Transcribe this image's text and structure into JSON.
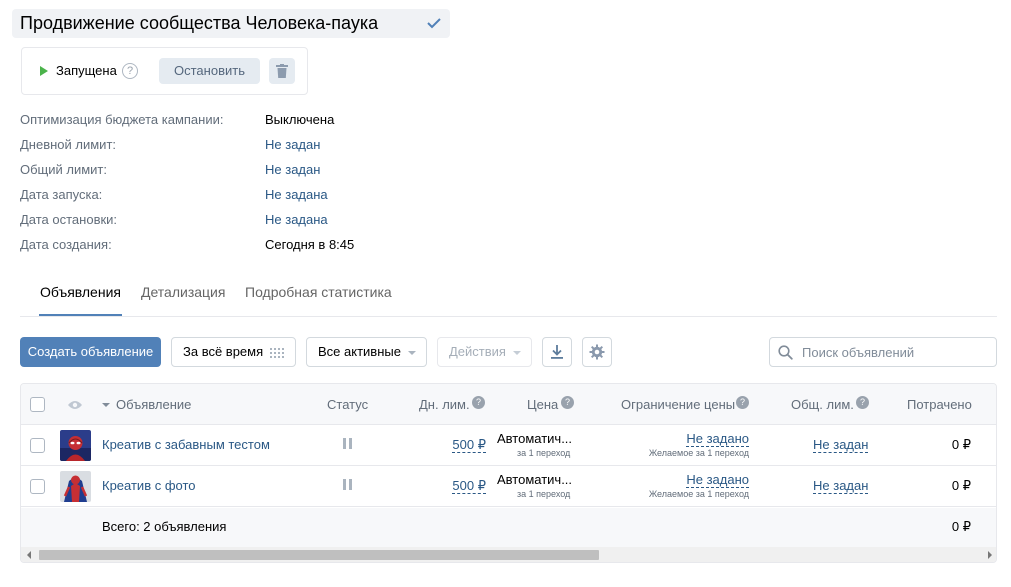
{
  "campaign": {
    "title": "Продвижение сообщества Человека-паука",
    "status_label": "Запущена",
    "help_glyph": "?",
    "stop_label": "Остановить"
  },
  "info": [
    {
      "label": "Оптимизация бюджета кампании:",
      "value": "Выключена",
      "link": false
    },
    {
      "label": "Дневной лимит:",
      "value": "Не задан",
      "link": true
    },
    {
      "label": "Общий лимит:",
      "value": "Не задан",
      "link": true
    },
    {
      "label": "Дата запуска:",
      "value": "Не задана",
      "link": true
    },
    {
      "label": "Дата остановки:",
      "value": "Не задана",
      "link": true
    },
    {
      "label": "Дата создания:",
      "value": "Сегодня в 8:45",
      "link": false
    }
  ],
  "tabs": [
    {
      "label": "Объявления",
      "active": true
    },
    {
      "label": "Детализация",
      "active": false
    },
    {
      "label": "Подробная статистика",
      "active": false
    }
  ],
  "toolbar": {
    "create_label": "Создать объявление",
    "period_label": "За всё время",
    "filter_label": "Все активные",
    "actions_label": "Действия",
    "search_placeholder": "Поиск объявлений"
  },
  "table": {
    "headers": {
      "ad": "Объявление",
      "status": "Статус",
      "daily_limit": "Дн. лим.",
      "price": "Цена",
      "price_limit": "Ограничение цены",
      "total_limit": "Общ. лим.",
      "spent": "Потрачено"
    },
    "rows": [
      {
        "name": "Креатив с забавным тестом",
        "daily_limit": "500 ₽",
        "price": "Автоматич...",
        "price_sub": "за 1 переход",
        "price_limit": "Не задано",
        "price_limit_sub": "Желаемое за 1 переход",
        "total_limit": "Не задан",
        "spent": "0 ₽"
      },
      {
        "name": "Креатив с фото",
        "daily_limit": "500 ₽",
        "price": "Автоматич...",
        "price_sub": "за 1 переход",
        "price_limit": "Не задано",
        "price_limit_sub": "Желаемое за 1 переход",
        "total_limit": "Не задан",
        "spent": "0 ₽"
      }
    ],
    "footer": {
      "total_label": "Всего: 2 объявления",
      "spent": "0 ₽"
    }
  },
  "colors": {
    "accent": "#5181b8",
    "link": "#2a5885",
    "running": "#4bb34b"
  }
}
